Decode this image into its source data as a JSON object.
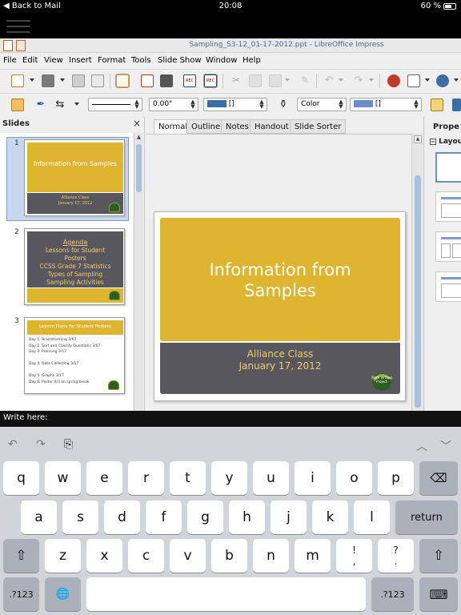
{
  "status_bar": {
    "back": "Back to Mail",
    "time": "20:08",
    "battery": "60 %"
  },
  "window": {
    "title": "Sampling_S3-12_01-17-2012.ppt - LibreOffice Impress"
  },
  "menu": [
    "File",
    "Edit",
    "View",
    "Insert",
    "Format",
    "Tools",
    "Slide Show",
    "Window",
    "Help"
  ],
  "toolbar2": {
    "line_width": "0.00\"",
    "area_color": "[]",
    "color_label": "Color",
    "color_value": "[]"
  },
  "slides_pane": {
    "header": "Slides",
    "close": "×"
  },
  "slides": [
    {
      "num": "1",
      "title": "Information from Samples",
      "sub1": "Alliance Class",
      "sub2": "January 17, 2012"
    },
    {
      "num": "2",
      "heading": "Agenda",
      "lines": [
        "Lessons for Student",
        "Posters",
        "CCSS Grade 7 Statistics",
        "Types of Sampling",
        "Sampling Activities"
      ]
    },
    {
      "num": "3",
      "heading": "Lesson Plans for Student Posters",
      "lines": [
        "Day 1: Brainstorming 3/07",
        "Day 2: Sort and Classify Questions 3/07",
        "Day 3: Planning 3/17",
        "Day 4: Data Collecting 3/17",
        "Day 5: Graphs 3/17",
        "Day 6: Poster 4/3 on spring break"
      ]
    }
  ],
  "tabs": [
    "Normal",
    "Outline",
    "Notes",
    "Handout",
    "Slide Sorter"
  ],
  "main_slide": {
    "title_line1": "Information from",
    "title_line2": "Samples",
    "sub1": "Alliance Class",
    "sub2": "January 17, 2012",
    "logo_text": "Math Writing Project"
  },
  "properties": {
    "header": "Prope",
    "layouts": "Layou",
    "collapse": "−"
  },
  "write_bar": "Write here:",
  "keyboard": {
    "row1": [
      "q",
      "w",
      "e",
      "r",
      "t",
      "y",
      "u",
      "i",
      "o",
      "p"
    ],
    "row2": [
      "a",
      "s",
      "d",
      "f",
      "g",
      "h",
      "j",
      "k",
      "l"
    ],
    "row3": [
      "z",
      "x",
      "c",
      "v",
      "b",
      "n",
      "m"
    ],
    "exclam": [
      "!",
      ","
    ],
    "question": [
      "?",
      "."
    ],
    "return": "return",
    "numbers": ".?123",
    "backspace": "⌫",
    "shift": "⇧",
    "globe": "🌐",
    "hide": "⌨",
    "undo": "↶",
    "redo": "↷",
    "paste": "⎘",
    "up": "︿",
    "down": "﹀"
  },
  "colors": {
    "yellow": "#ddb52f",
    "gray": "#59575e",
    "accent": "#7f9ccb"
  }
}
